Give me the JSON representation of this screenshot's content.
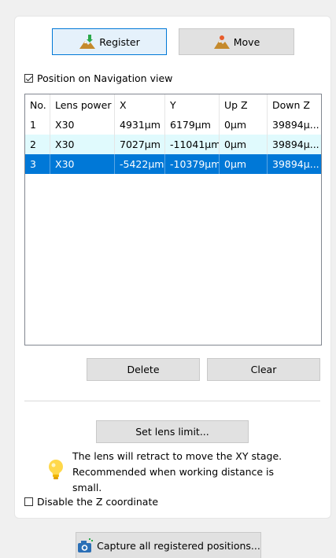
{
  "toolbar": {
    "register_label": "Register",
    "move_label": "Move"
  },
  "options": {
    "position_nav_label": "Position on Navigation view",
    "position_nav_checked": true,
    "disable_z_label": "Disable the Z coordinate",
    "disable_z_checked": false
  },
  "table": {
    "columns": [
      "No.",
      "Lens power",
      "X",
      "Y",
      "Up Z",
      "Down Z"
    ],
    "rows": [
      [
        "1",
        "X30",
        "4931µm",
        "6179µm",
        "0µm",
        "39894µ..."
      ],
      [
        "2",
        "X30",
        "7027µm",
        "-11041µm",
        "0µm",
        "39894µ..."
      ],
      [
        "3",
        "X30",
        "-5422µm",
        "-10379µm",
        "0µm",
        "39894µ..."
      ]
    ],
    "selected_row": 3
  },
  "actions": {
    "delete_label": "Delete",
    "clear_label": "Clear",
    "set_lens_limit_label": "Set lens limit..."
  },
  "tip": {
    "text": "The lens will retract to move the XY stage. Recommended when working distance is small.",
    "icon": "lightbulb-icon"
  },
  "footer": {
    "capture_label": "Capture all registered positions..."
  },
  "colors": {
    "selection": "#0078d7",
    "alt_row": "#e0fafd",
    "primary_border": "#0078d7"
  }
}
